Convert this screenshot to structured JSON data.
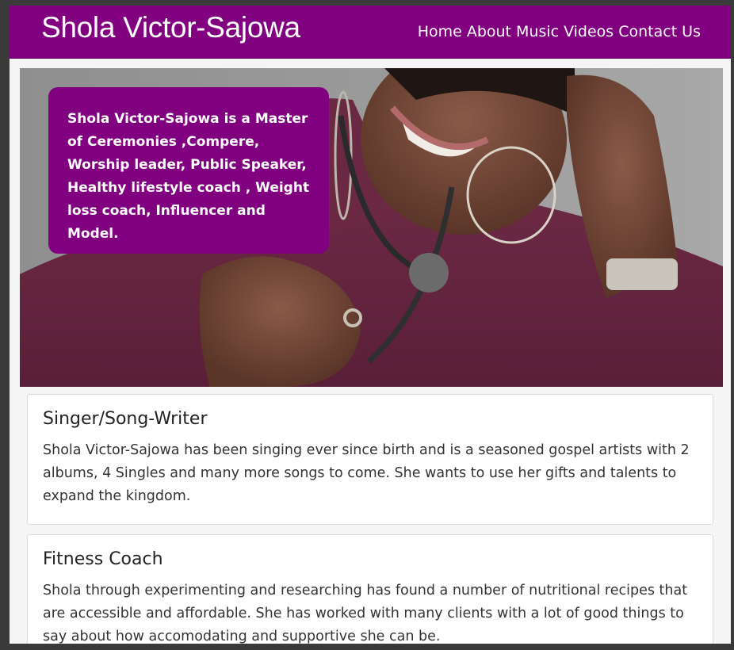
{
  "site": {
    "brand": "Shola Victor-Sajowa"
  },
  "nav": {
    "items": [
      {
        "label": "Home"
      },
      {
        "label": "About"
      },
      {
        "label": "Music"
      },
      {
        "label": "Videos"
      },
      {
        "label": "Contact Us"
      }
    ]
  },
  "hero": {
    "intro": "Shola Victor-Sajowa is a Master of Ceremonies ,Compere, Worship leader, Public Speaker, Healthy lifestyle coach , Weight loss coach, Influencer and Model."
  },
  "sections": [
    {
      "title": "Singer/Song-Writer",
      "text": "Shola Victor-Sajowa has been singing ever since birth and is a seasoned gospel artists with 2 albums, 4 Singles and many more songs to come. She wants to use her gifts and talents to expand the kingdom."
    },
    {
      "title": "Fitness Coach",
      "text": "Shola through experimenting and researching has found a number of nutritional recipes that are accessible and affordable. She has worked with many clients with a lot of good things to say about how accomodating and supportive she can be."
    }
  ],
  "colors": {
    "brand_purple": "#800080",
    "page_bg": "#f5f5f5",
    "card_bg": "#ffffff"
  }
}
